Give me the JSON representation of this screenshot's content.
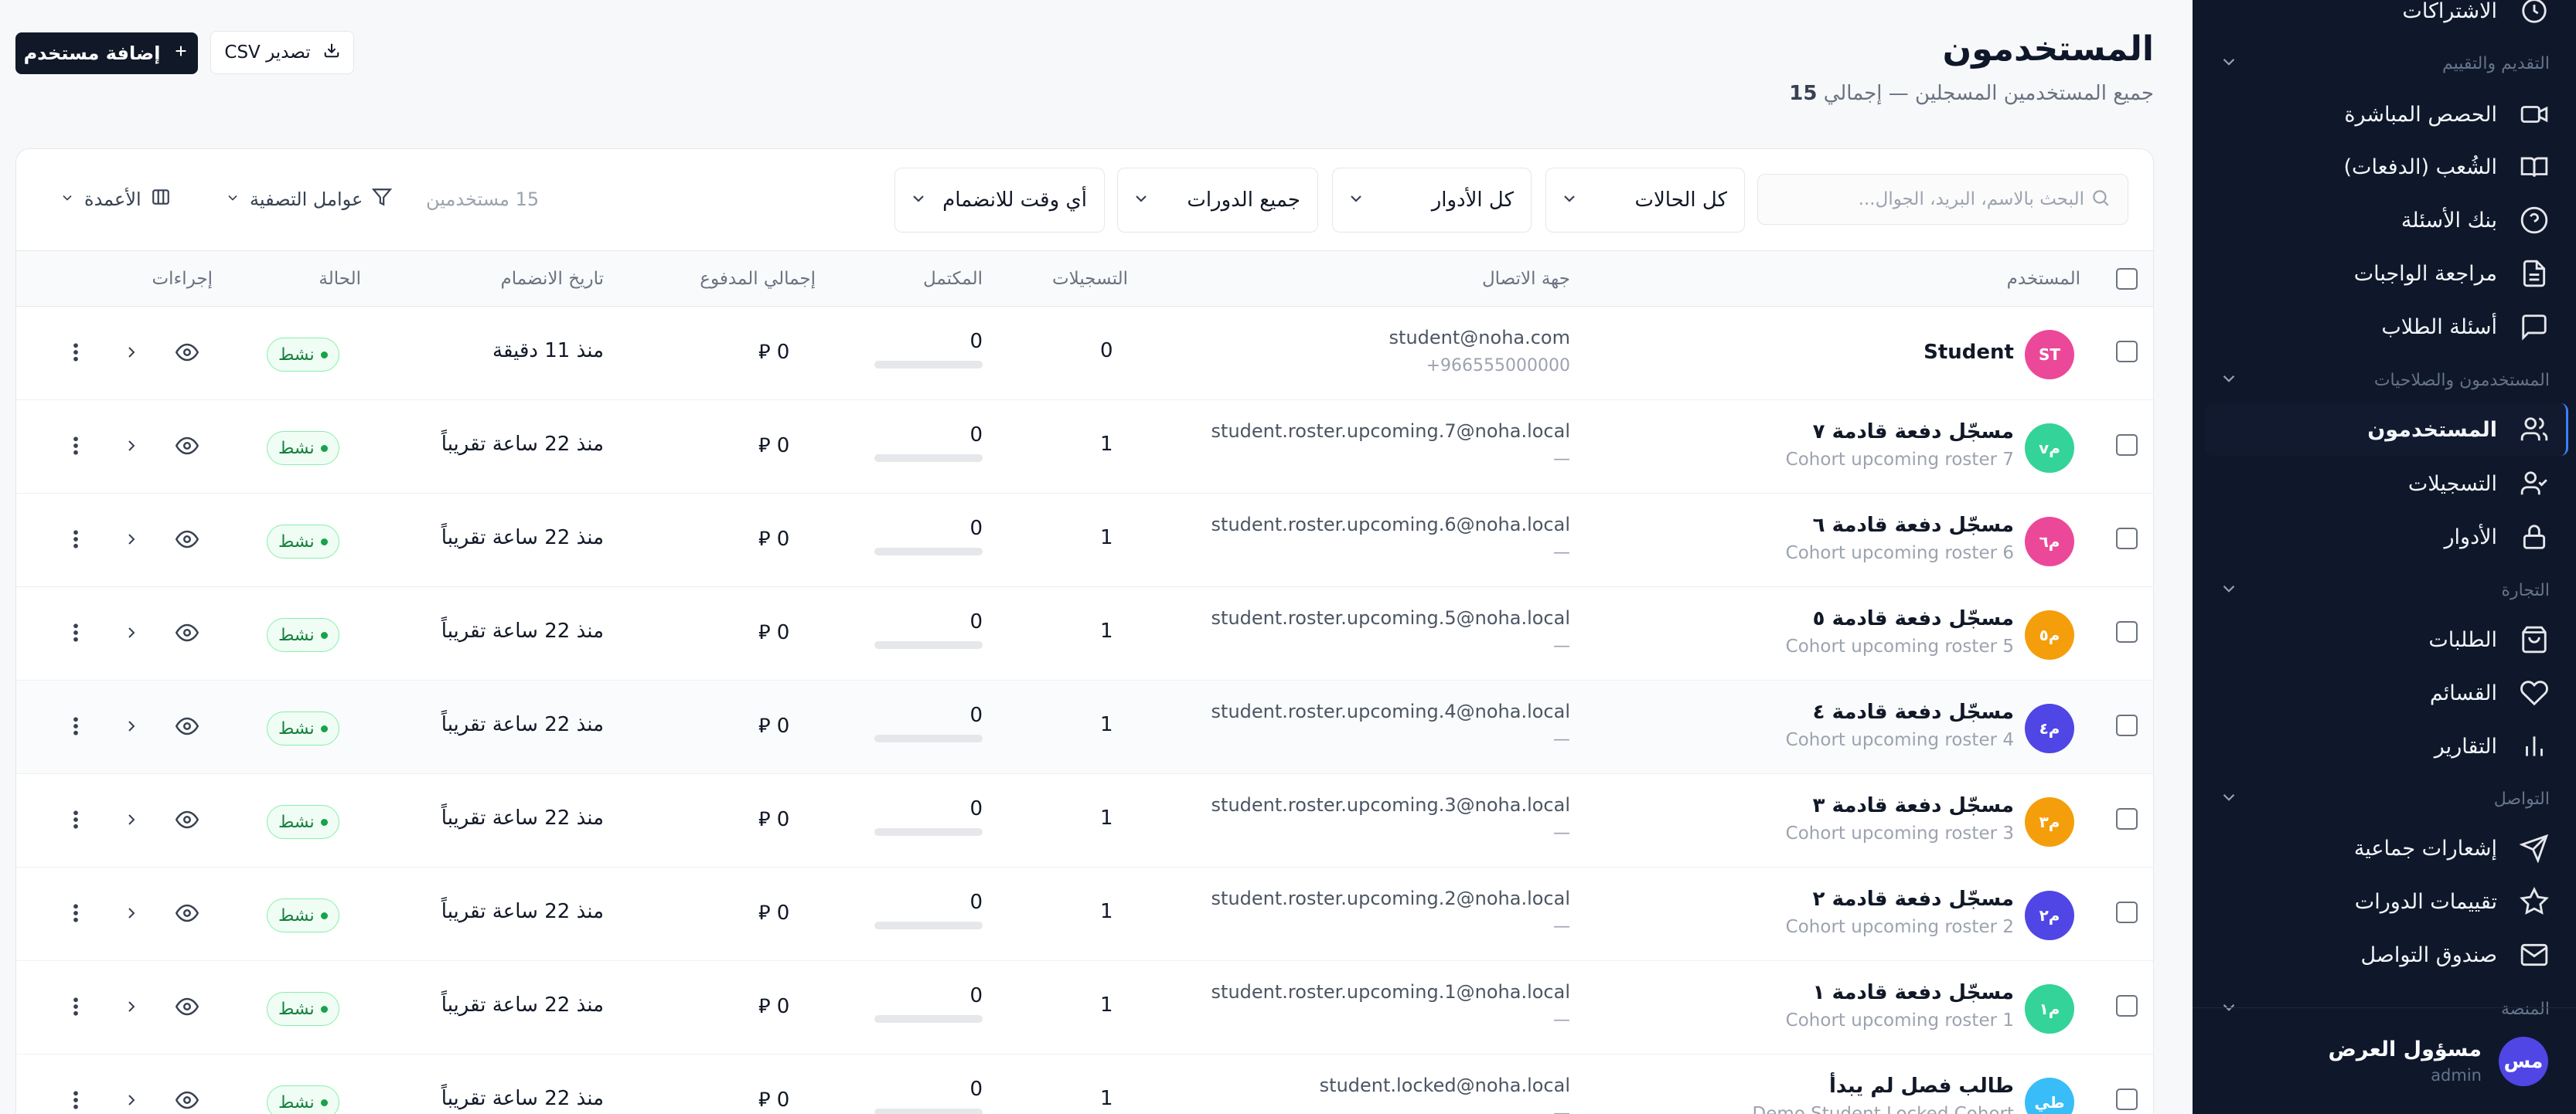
{
  "header": {
    "title": "المستخدمون",
    "subtitle_prefix": "جميع المستخدمين المسجلين — إجمالي",
    "total": "15",
    "add_user_label": "إضافة مستخدم",
    "export_label": "تصدير CSV"
  },
  "sidebar": {
    "items": [
      {
        "id": "live",
        "label": "الحصص المباشرة",
        "icon": "video-icon"
      },
      {
        "id": "cohorts",
        "label": "الشُعب (الدفعات)",
        "icon": "book-open-icon"
      },
      {
        "id": "questions",
        "label": "بنك الأسئلة",
        "icon": "help-circle-icon"
      },
      {
        "id": "homework",
        "label": "مراجعة الواجبات",
        "icon": "file-text-icon"
      },
      {
        "id": "student-questions",
        "label": "أسئلة الطلاب",
        "icon": "message-square-icon"
      },
      {
        "id": "users",
        "label": "المستخدمون",
        "icon": "users-icon",
        "active": true
      },
      {
        "id": "enrollments",
        "label": "التسجيلات",
        "icon": "user-check-icon"
      },
      {
        "id": "roles",
        "label": "الأدوار",
        "icon": "lock-icon"
      },
      {
        "id": "orders",
        "label": "الطلبات",
        "icon": "shopping-bag-icon"
      },
      {
        "id": "wishlists",
        "label": "القسائم",
        "icon": "heart-icon"
      },
      {
        "id": "reports",
        "label": "التقارير",
        "icon": "bar-chart-icon"
      },
      {
        "id": "broadcasts",
        "label": "إشعارات جماعية",
        "icon": "send-icon"
      },
      {
        "id": "course-reviews",
        "label": "تقييمات الدورات",
        "icon": "star-icon"
      },
      {
        "id": "inbox",
        "label": "صندوق التواصل",
        "icon": "mail-icon"
      }
    ],
    "sections": {
      "top_partial": "الاشتراكات",
      "teaching": "التقديم والتقييم",
      "users_perms": "المستخدمون والصلاحيات",
      "commerce": "التجارة",
      "communication": "التواصل",
      "platform": "المنصة"
    },
    "user": {
      "name": "مسؤول العرض",
      "role": "admin",
      "initials": "مس"
    }
  },
  "toolbar": {
    "search_placeholder": "البحث بالاسم، البريد، الجوال...",
    "status_select": "كل الحالات",
    "role_select": "كل الأدوار",
    "course_select": "جميع الدورات",
    "joined_select": "أي وقت للانضمام",
    "count_text": "15 مستخدمين",
    "filters_label": "عوامل التصفية",
    "columns_label": "الأعمدة"
  },
  "table": {
    "headers": {
      "user": "المستخدم",
      "contact": "جهة الاتصال",
      "enrollments": "التسجيلات",
      "completed": "المكتمل",
      "paid": "إجمالي المدفوع",
      "joined": "تاريخ الانضمام",
      "status": "الحالة",
      "actions": "إجراءات"
    },
    "currency_symbol": "⃁",
    "rows": [
      {
        "initials": "ST",
        "color": "#ec4899",
        "name": "Student",
        "sub": "",
        "email": "student@noha.com",
        "phone": "+966555000000",
        "enrollments": "0",
        "completed": "0",
        "completed_pct": 0,
        "paid": "0",
        "joined": "منذ 11 دقيقة",
        "status": "نشط"
      },
      {
        "initials": "مv",
        "color": "#34d399",
        "name": "مسجّل دفعة قادمة ٧",
        "sub": "Cohort upcoming roster 7",
        "email": "student.roster.upcoming.7@noha.local",
        "phone": "—",
        "enrollments": "1",
        "completed": "0",
        "completed_pct": 0,
        "paid": "0",
        "joined": "منذ 22 ساعة تقريباً",
        "status": "نشط"
      },
      {
        "initials": "م٦",
        "color": "#ec4899",
        "name": "مسجّل دفعة قادمة ٦",
        "sub": "Cohort upcoming roster 6",
        "email": "student.roster.upcoming.6@noha.local",
        "phone": "—",
        "enrollments": "1",
        "completed": "0",
        "completed_pct": 0,
        "paid": "0",
        "joined": "منذ 22 ساعة تقريباً",
        "status": "نشط"
      },
      {
        "initials": "م٥",
        "color": "#f59e0b",
        "name": "مسجّل دفعة قادمة ٥",
        "sub": "Cohort upcoming roster 5",
        "email": "student.roster.upcoming.5@noha.local",
        "phone": "—",
        "enrollments": "1",
        "completed": "0",
        "completed_pct": 0,
        "paid": "0",
        "joined": "منذ 22 ساعة تقريباً",
        "status": "نشط"
      },
      {
        "initials": "م٤",
        "color": "#4f46e5",
        "name": "مسجّل دفعة قادمة ٤",
        "sub": "Cohort upcoming roster 4",
        "email": "student.roster.upcoming.4@noha.local",
        "phone": "—",
        "enrollments": "1",
        "completed": "0",
        "completed_pct": 0,
        "paid": "0",
        "joined": "منذ 22 ساعة تقريباً",
        "status": "نشط"
      },
      {
        "initials": "م٣",
        "color": "#f59e0b",
        "name": "مسجّل دفعة قادمة ٣",
        "sub": "Cohort upcoming roster 3",
        "email": "student.roster.upcoming.3@noha.local",
        "phone": "—",
        "enrollments": "1",
        "completed": "0",
        "completed_pct": 0,
        "paid": "0",
        "joined": "منذ 22 ساعة تقريباً",
        "status": "نشط"
      },
      {
        "initials": "م٢",
        "color": "#4f46e5",
        "name": "مسجّل دفعة قادمة ٢",
        "sub": "Cohort upcoming roster 2",
        "email": "student.roster.upcoming.2@noha.local",
        "phone": "—",
        "enrollments": "1",
        "completed": "0",
        "completed_pct": 0,
        "paid": "0",
        "joined": "منذ 22 ساعة تقريباً",
        "status": "نشط"
      },
      {
        "initials": "م١",
        "color": "#34d399",
        "name": "مسجّل دفعة قادمة ١",
        "sub": "Cohort upcoming roster 1",
        "email": "student.roster.upcoming.1@noha.local",
        "phone": "—",
        "enrollments": "1",
        "completed": "0",
        "completed_pct": 0,
        "paid": "0",
        "joined": "منذ 22 ساعة تقريباً",
        "status": "نشط"
      },
      {
        "initials": "طي",
        "color": "#38bdf8",
        "name": "طالب فصل لم يبدأ",
        "sub": "Demo Student Locked Cohort",
        "email": "student.locked@noha.local",
        "phone": "—",
        "enrollments": "1",
        "completed": "0",
        "completed_pct": 0,
        "paid": "0",
        "joined": "منذ 22 ساعة تقريباً",
        "status": "نشط"
      }
    ]
  }
}
